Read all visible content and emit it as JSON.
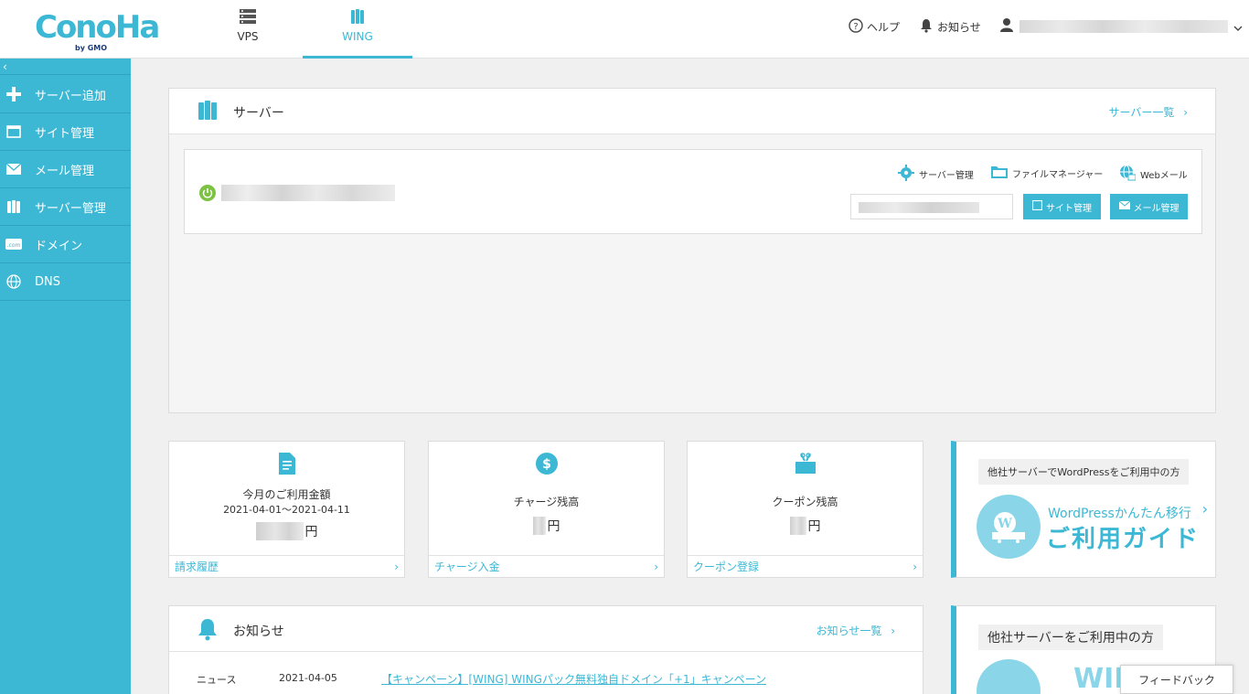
{
  "logo": {
    "text": "ConoHa",
    "sub": "by GMO"
  },
  "topnav": {
    "tabs": [
      {
        "label": "VPS"
      },
      {
        "label": "WING"
      }
    ]
  },
  "header": {
    "help": "ヘルプ",
    "notice": "お知らせ"
  },
  "sidebar": {
    "collapse": "‹",
    "items": [
      {
        "label": "サーバー追加"
      },
      {
        "label": "サイト管理"
      },
      {
        "label": "メール管理"
      },
      {
        "label": "サーバー管理"
      },
      {
        "label": "ドメイン"
      },
      {
        "label": "DNS"
      }
    ]
  },
  "server_panel": {
    "title": "サーバー",
    "list_link": "サーバー一覧",
    "tools": {
      "server_manage": "サーバー管理",
      "file_manager": "ファイルマネージャー",
      "webmail": "Webメール"
    },
    "buttons": {
      "site_manage": "サイト管理",
      "mail_manage": "メール管理"
    }
  },
  "stats": [
    {
      "title": "今月のご利用金額",
      "sub": "2021-04-01～2021-04-11",
      "unit": "円",
      "footer": "請求履歴"
    },
    {
      "title": "チャージ残高",
      "unit": "円",
      "footer": "チャージ入金"
    },
    {
      "title": "クーポン残高",
      "unit": "円",
      "footer": "クーポン登録"
    }
  ],
  "promo_wp": {
    "tag": "他社サーバーでWordPressをご利用中の方",
    "line1": "WordPressかんたん移行",
    "line2": "ご利用ガイド"
  },
  "news": {
    "title": "お知らせ",
    "all_link": "お知らせ一覧",
    "items": [
      {
        "category": "ニュース",
        "date": "2021-04-05",
        "headline": "【キャンペーン】[WING] WINGパック無料独自ドメイン「+1」キャンペーン"
      }
    ]
  },
  "promo_other": {
    "tag": "他社サーバーをご利用中の方",
    "brand": "WIN"
  },
  "feedback": "フィードバック",
  "colors": {
    "accent": "#3cb8d5",
    "power_on": "#7dc242"
  }
}
